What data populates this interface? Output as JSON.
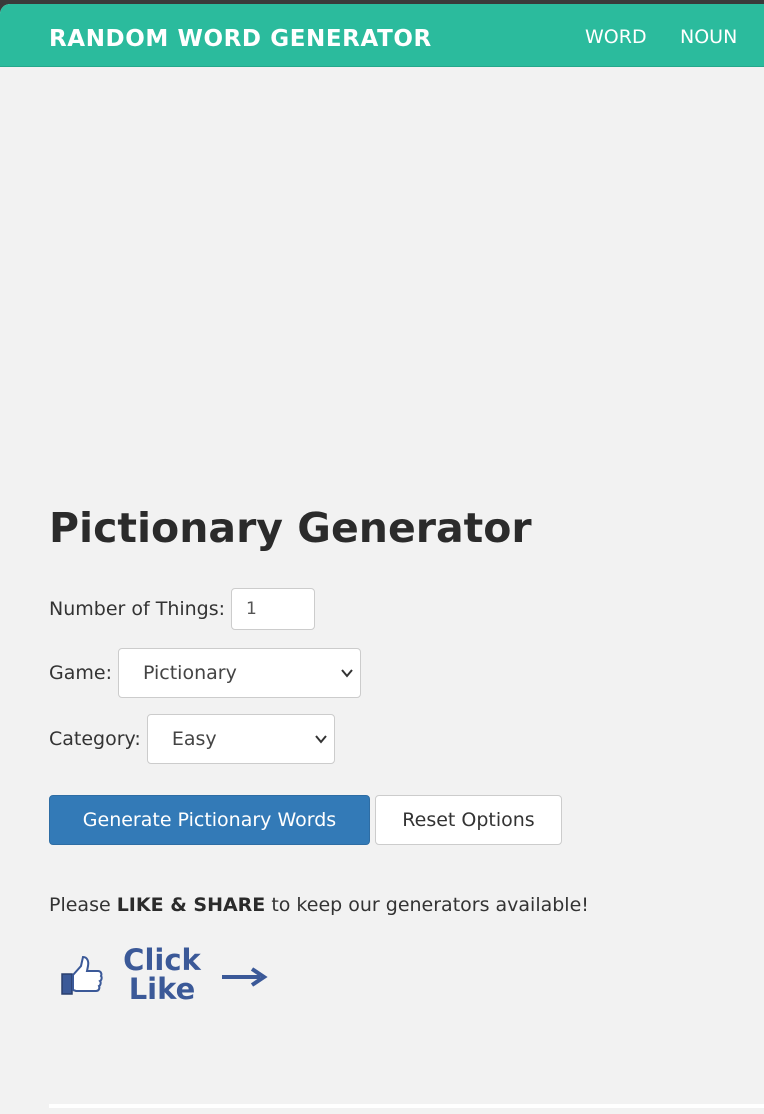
{
  "header": {
    "brand": "RANDOM WORD GENERATOR",
    "nav": [
      {
        "label": "WORD"
      },
      {
        "label": "NOUN"
      }
    ],
    "accent_color": "#2bbb9d"
  },
  "main": {
    "title": "Pictionary Generator",
    "count": {
      "label": "Number of Things:",
      "value": "1"
    },
    "game": {
      "label": "Game:",
      "selected": "Pictionary"
    },
    "category": {
      "label": "Category:",
      "selected": "Easy"
    },
    "generate_button": "Generate Pictionary Words",
    "reset_button": "Reset Options",
    "share": {
      "prefix": "Please ",
      "bold": "LIKE & SHARE",
      "suffix": " to keep our generators available!"
    },
    "like_widget": {
      "line1": "Click",
      "line2": "Like",
      "icons": [
        "thumbs-up-icon",
        "arrow-right-icon"
      ],
      "color": "#3b5998"
    }
  }
}
